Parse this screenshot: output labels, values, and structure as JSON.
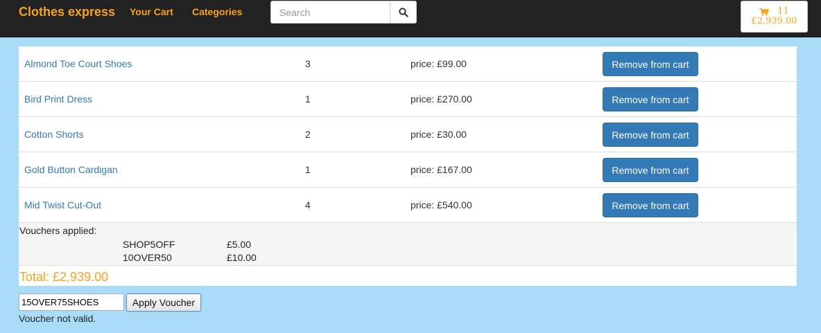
{
  "nav": {
    "brand": "Clothes express",
    "links": [
      "Your Cart",
      "Categories"
    ],
    "search_placeholder": "Search",
    "cart_count": "11",
    "cart_total": "£2,939.00"
  },
  "cart": {
    "items": [
      {
        "name": "Almond Toe Court Shoes",
        "qty": "3",
        "price": "price: £99.00",
        "action": "Remove from cart"
      },
      {
        "name": "Bird Print Dress",
        "qty": "1",
        "price": "price: £270.00",
        "action": "Remove from cart"
      },
      {
        "name": "Cotton Shorts",
        "qty": "2",
        "price": "price: £30.00",
        "action": "Remove from cart"
      },
      {
        "name": "Gold Button Cardigan",
        "qty": "1",
        "price": "price: £167.00",
        "action": "Remove from cart"
      },
      {
        "name": "Mid Twist Cut-Out",
        "qty": "4",
        "price": "price: £540.00",
        "action": "Remove from cart"
      }
    ],
    "vouchers_title": "Vouchers applied:",
    "vouchers": [
      {
        "code": "SHOP5OFF",
        "amount": "£5.00"
      },
      {
        "code": "10OVER50",
        "amount": "£10.00"
      }
    ],
    "total": "Total: £2,939.00"
  },
  "voucher_form": {
    "input_value": "15OVER75SHOES",
    "apply_label": "Apply Voucher",
    "message": "Voucher not valid."
  },
  "colors": {
    "accent": "#f7a41d",
    "link": "#337ab7",
    "navbar": "#222222",
    "background": "#a8dcf8"
  }
}
